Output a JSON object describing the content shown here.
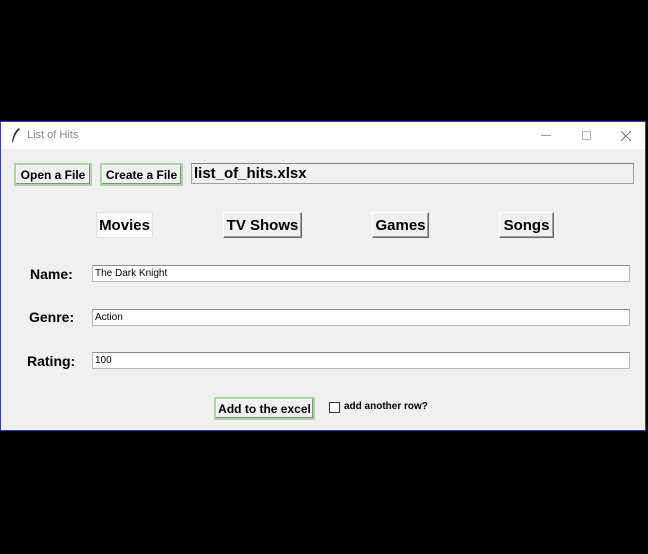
{
  "window": {
    "title": "List of Hits"
  },
  "toolbar": {
    "open_label": "Open a File",
    "create_label": "Create a File",
    "filename": "list_of_hits.xlsx"
  },
  "tabs": [
    {
      "label": "Movies",
      "active": true
    },
    {
      "label": "TV Shows",
      "active": false
    },
    {
      "label": "Games",
      "active": false
    },
    {
      "label": "Songs",
      "active": false
    }
  ],
  "form": {
    "name_label": "Name:",
    "name_value": "The Dark Knight",
    "genre_label": "Genre:",
    "genre_value": "Action",
    "rating_label": "Rating:",
    "rating_value": "100"
  },
  "actions": {
    "add_label": "Add to the excel",
    "add_row_label": "add another row?",
    "add_row_checked": false
  },
  "colors": {
    "window_bg": "#f0f0f0",
    "button_highlight": "#a8d4a8",
    "window_border": "#3c3cb0"
  }
}
